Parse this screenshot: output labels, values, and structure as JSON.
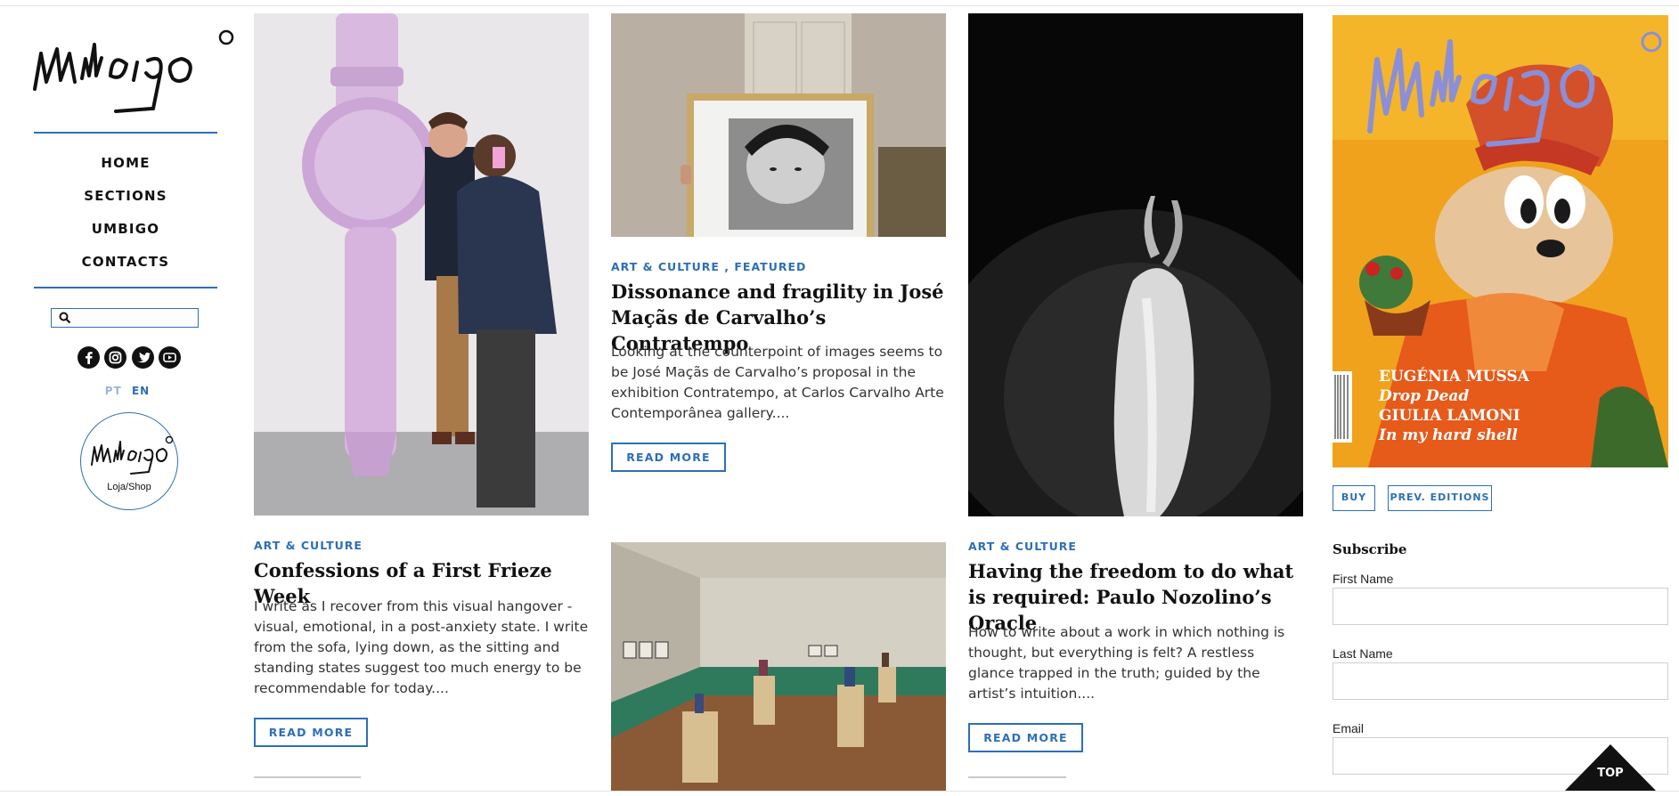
{
  "site": {
    "logo_text": "umbigo",
    "nav": [
      "HOME",
      "SECTIONS",
      "UMBIGO",
      "CONTACTS"
    ],
    "search_placeholder": "",
    "social_icons": [
      "facebook-icon",
      "instagram-icon",
      "twitter-icon",
      "youtube-icon"
    ],
    "lang_pt": "PT",
    "lang_en": "EN",
    "shop_logo_text": "umbigo",
    "shop_label": "Loja/Shop",
    "accent_color": "#2d6fb7"
  },
  "articles": [
    {
      "category": "ART & CULTURE",
      "title": "Confessions of a First Frieze Week",
      "excerpt": "I write as I recover from this visual hangover - visual, emotional, in a post-anxiety state. I write from the sofa, lying down, as the sitting and standing states suggest too much energy to be recommendable for today....",
      "button": "READ MORE",
      "image": "man posing beside giant pink watch sculpture"
    },
    {
      "category": "ART & CULTURE , FEATURED",
      "title": "Dissonance and fragility in José Maçãs de Carvalho’s Contratempo",
      "excerpt": "Looking at the counterpoint of images seems to be José Maçãs de Carvalho’s proposal in the exhibition Contratempo, at Carlos Carvalho Arte Contemporânea gallery....",
      "button": "READ MORE",
      "image": "framed portrait held in a room"
    },
    {
      "category": "ART & CULTURE",
      "title": "Having the freedom to do what is required: Paulo Nozolino’s Oracle",
      "excerpt": "How to write about a work in which nothing is thought, but everything is felt? A restless glance trapped in the truth; guided by the artist’s intuition....",
      "button": "READ MORE",
      "image": "goat in darkness photograph"
    },
    {
      "image": "gallery room with sculptures on pedestals"
    }
  ],
  "magazine": {
    "cover_lines": [
      "EUGÉNIA MUSSA",
      "Drop Dead",
      "GIULIA LAMONI",
      "In my hard shell"
    ],
    "buy_label": "BUY",
    "prev_label": "PREV. EDITIONS"
  },
  "subscribe": {
    "heading": "Subscribe",
    "first_name_label": "First Name",
    "last_name_label": "Last Name",
    "email_label": "Email"
  },
  "top_button": "TOP"
}
